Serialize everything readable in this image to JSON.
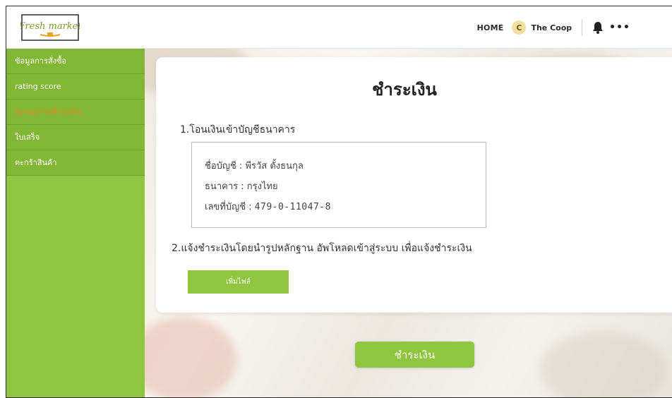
{
  "header": {
    "logo_text": "Fresh market",
    "home_label": "HOME",
    "avatar_letter": "C",
    "store_name": "The Coop",
    "more_label": "•••"
  },
  "sidebar": {
    "items": [
      {
        "label": "ข้อมูลการสั่งซื้อ",
        "active": false
      },
      {
        "label": "rating score",
        "active": false
      },
      {
        "label": "สถานะการชำระเงิน",
        "active": true
      },
      {
        "label": "ใบเสร็จ",
        "active": false
      },
      {
        "label": "ตะกร้าสินค้า",
        "active": false
      }
    ]
  },
  "main": {
    "title": "ชำระเงิน",
    "step1": "1.โอนเงินเข้าบัญชีธนาคาร",
    "bank": {
      "name_label": "ชื่อบัญชี : ",
      "name_value": "พีรวัส ตั้งธนกุล",
      "bank_label": "ธนาคาร : ",
      "bank_value": "กรุงไทย",
      "number_label": "เลขที่บัญชี : ",
      "number_value": "479-0-11047-8"
    },
    "step2": "2.แจ้งชำระเงินโดยนำรูปหลักฐาน อัพโหลดเข้าสู่ระบบ เพื่อแจ้งชำระเงิน",
    "add_file_label": "เพิ่มไฟล์",
    "pay_button_label": "ชำระเงิน"
  },
  "colors": {
    "accent_green": "#8fc53f",
    "active_orange": "#f58220"
  }
}
